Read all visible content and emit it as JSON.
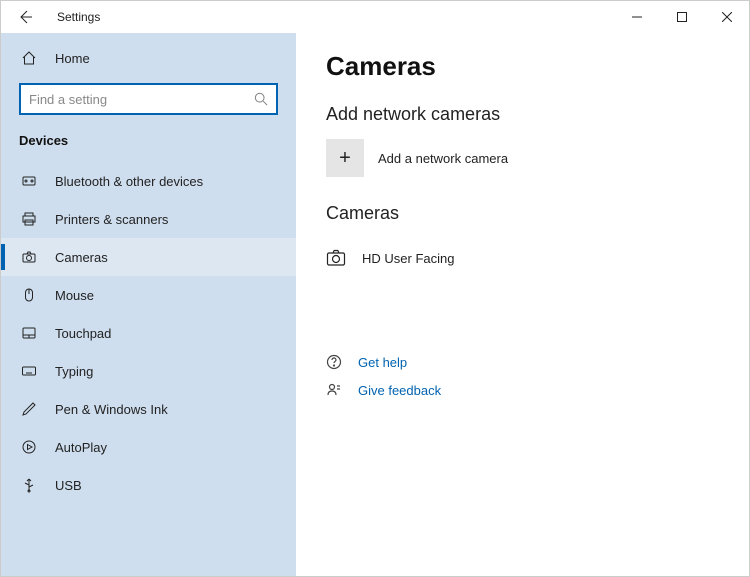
{
  "titlebar": {
    "title": "Settings"
  },
  "sidebar": {
    "home_label": "Home",
    "search_placeholder": "Find a setting",
    "section_label": "Devices",
    "items": [
      {
        "label": "Bluetooth & other devices"
      },
      {
        "label": "Printers & scanners"
      },
      {
        "label": "Cameras"
      },
      {
        "label": "Mouse"
      },
      {
        "label": "Touchpad"
      },
      {
        "label": "Typing"
      },
      {
        "label": "Pen & Windows Ink"
      },
      {
        "label": "AutoPlay"
      },
      {
        "label": "USB"
      }
    ]
  },
  "content": {
    "page_title": "Cameras",
    "add_section_title": "Add network cameras",
    "add_button_label": "Add a network camera",
    "cameras_section_title": "Cameras",
    "cameras": [
      {
        "label": "HD User Facing"
      }
    ],
    "help_label": "Get help",
    "feedback_label": "Give feedback"
  }
}
